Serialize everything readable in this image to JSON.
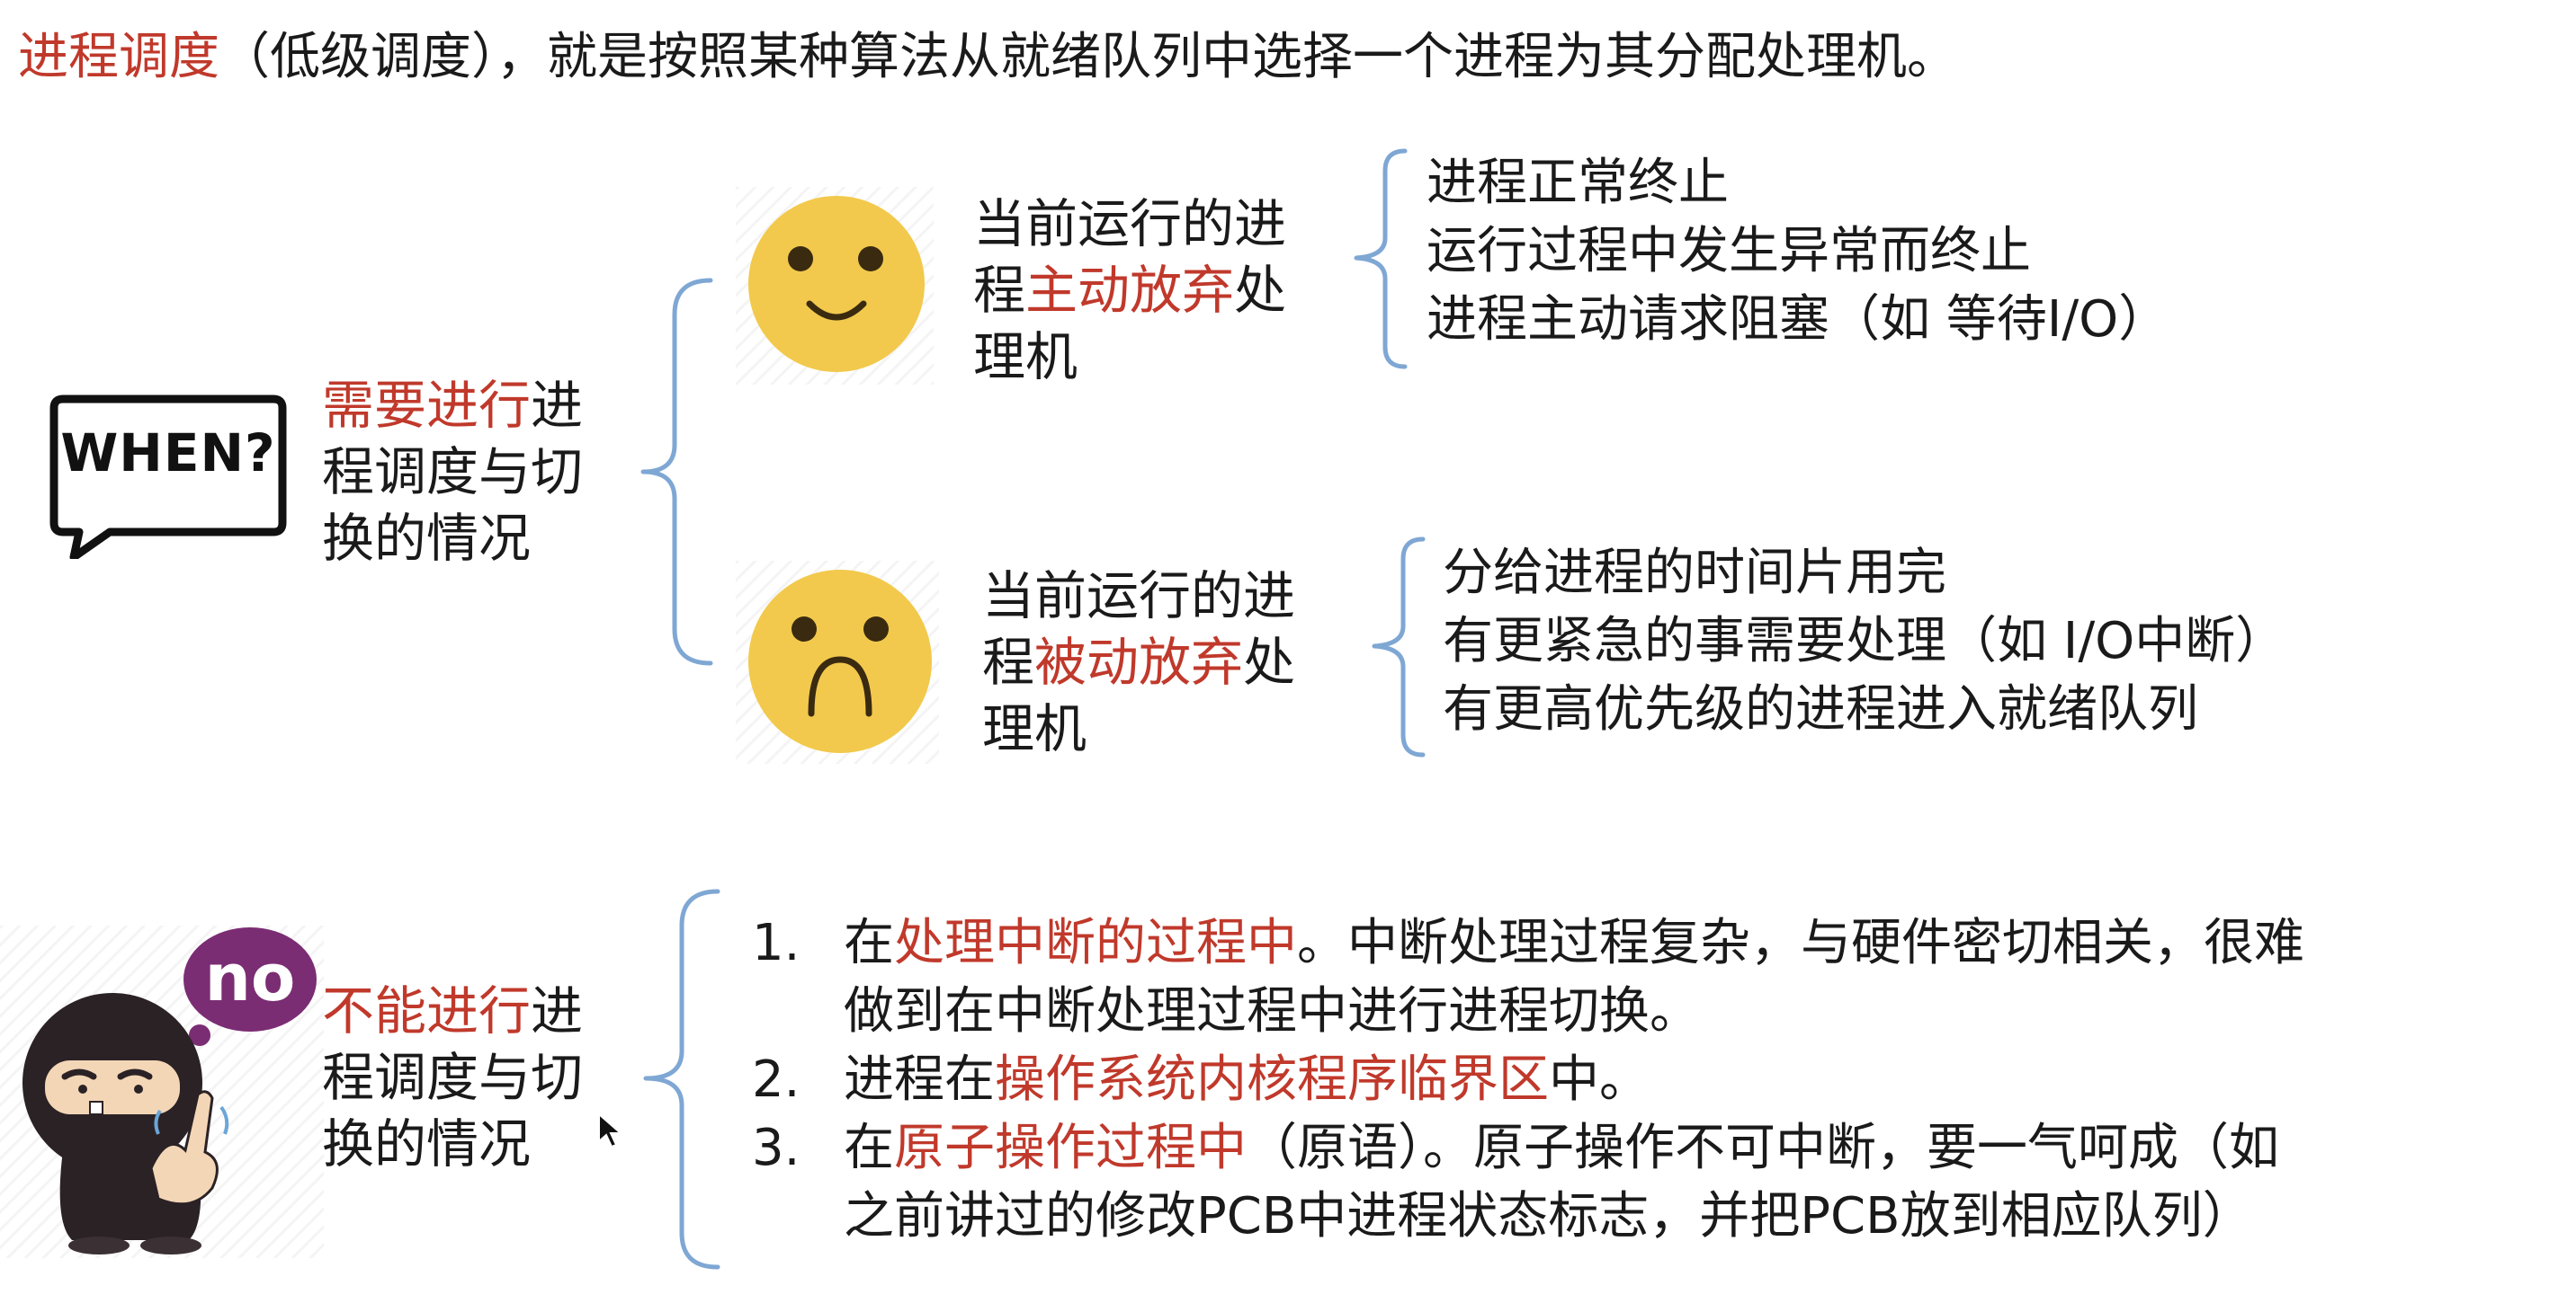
{
  "title": {
    "highlight": "进程调度",
    "rest": "（低级调度），就是按照某种算法从就绪队列中选择一个进程为其分配处理机。"
  },
  "when_badge": {
    "text": "WHEN?"
  },
  "need_switch": {
    "highlight": "需要进行",
    "line1_rest": "进",
    "line2": "程调度与切",
    "line3": "换的情况"
  },
  "active_giveup": {
    "line1": "当前运行的进",
    "line2_pre": "程",
    "line2_highlight": "主动放弃",
    "line2_post": "处",
    "line3": "理机",
    "items": [
      "进程正常终止",
      "运行过程中发生异常而终止",
      "进程主动请求阻塞（如 等待I/O）"
    ]
  },
  "passive_giveup": {
    "line1": "当前运行的进",
    "line2_pre": "程",
    "line2_highlight": "被动放弃",
    "line2_post": "处",
    "line3": "理机",
    "items": [
      "分给进程的时间片用完",
      "有更紧急的事需要处理（如 I/O中断）",
      "有更高优先级的进程进入就绪队列"
    ]
  },
  "no_badge": {
    "text": "no"
  },
  "cannot_switch": {
    "highlight": "不能进行",
    "line1_rest": "进",
    "line2": "程调度与切",
    "line3": "换的情况"
  },
  "cannot_list": [
    {
      "num": "1.",
      "pre": "在",
      "highlight": "处理中断的过程中",
      "post": "。中断处理过程复杂，与硬件密切相关，很难",
      "cont": "做到在中断处理过程中进行进程切换。"
    },
    {
      "num": "2.",
      "pre": "进程在",
      "highlight": "操作系统内核程序临界区",
      "post": "中。",
      "cont": ""
    },
    {
      "num": "3.",
      "pre": "在",
      "highlight": "原子操作过程中",
      "post": "（原语）。原子操作不可中断，要一气呵成（如",
      "cont": "之前讲过的修改PCB中进程状态标志，并把PCB放到相应队列）"
    }
  ],
  "colors": {
    "highlight": "#c0392b",
    "bracket": "#7fa7d4",
    "smiley": "#f2c94c",
    "face_feature": "#3a2a10",
    "ninja": "#2b2226",
    "no_bubble": "#7b2d73"
  }
}
